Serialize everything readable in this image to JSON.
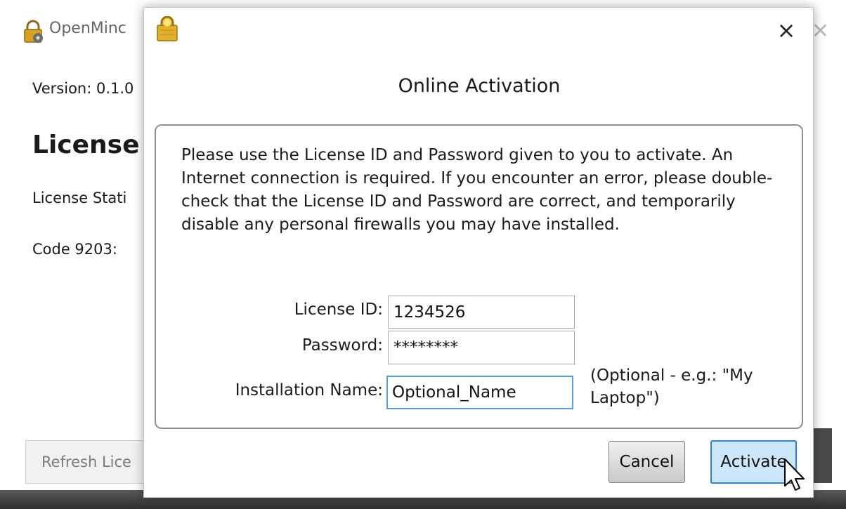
{
  "background_window": {
    "title": "OpenMinc",
    "version_text": "Version: 0.1.0",
    "heading": "License",
    "status_text": "License Stati",
    "code_text": "Code 9203:",
    "refresh_button_label": "Refresh Lice"
  },
  "dialog": {
    "title": "Online Activation",
    "close_label": "×",
    "description": "Please use the License ID and Password given to you to activate. An Internet connection is required.  If you encounter an error, please double-check that the License ID and Password are correct, and temporarily disable any personal firewalls you may have installed.",
    "fields": {
      "license_id": {
        "label": "License ID:",
        "value": "1234526"
      },
      "password": {
        "label": "Password:",
        "value": "********"
      },
      "installation_name": {
        "label": "Installation Name:",
        "value": "Optional_Name",
        "hint": "(Optional - e.g.: \"My Laptop\")"
      }
    },
    "buttons": {
      "cancel": "Cancel",
      "activate": "Activate"
    }
  },
  "colors": {
    "accent": "#2b82d6",
    "activate_bg": "#cce7fb",
    "focus_border": "#5b9bd5"
  }
}
